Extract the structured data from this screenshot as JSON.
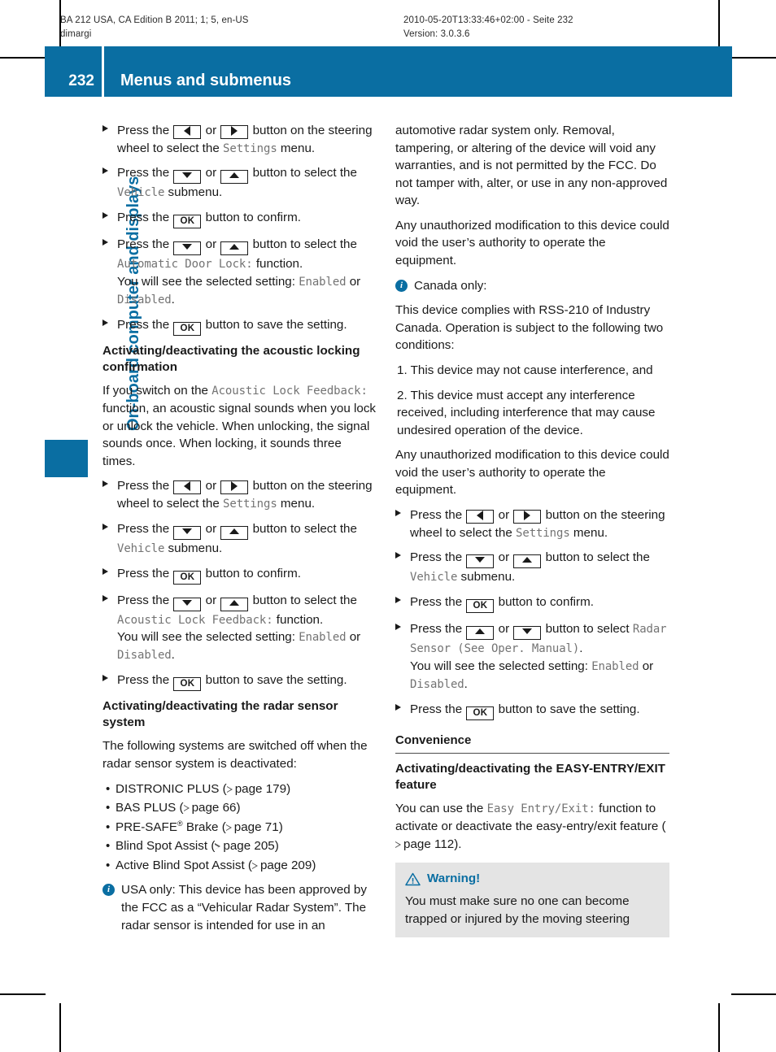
{
  "runhead": {
    "left_line1": "BA 212 USA, CA Edition B 2011; 1; 5, en-US",
    "left_line2": "dimargi",
    "right_line1": "2010-05-20T13:33:46+02:00 - Seite 232",
    "right_line2": "Version: 3.0.3.6"
  },
  "header": {
    "page_number": "232",
    "title": "Menus and submenus",
    "accent_color": "#0a6ea2"
  },
  "chapter_tab": {
    "label": "On-board computer and displays"
  },
  "left_column": {
    "steps_door_lock": [
      {
        "t1": "Press the",
        "btn_a": "arrow-left",
        "or": "or",
        "btn_b": "arrow-right",
        "t2": "button on the steering wheel to select the",
        "mono": "Settings",
        "t3": "menu."
      },
      {
        "t1": "Press the",
        "btn_a": "arrow-down",
        "or": "or",
        "btn_b": "arrow-up",
        "t2": "button to select the",
        "mono": "Vehicle",
        "t3": "submenu."
      },
      {
        "t1": "Press the",
        "btn_a": "OK",
        "t2": "button to confirm."
      },
      {
        "t1": "Press the",
        "btn_a": "arrow-down",
        "or": "or",
        "btn_b": "arrow-up",
        "t2": "button to select the",
        "mono": "Automatic Door Lock:",
        "t3": "function.",
        "t4": "You will see the selected setting:",
        "mono2": "Enabled",
        "t5": "or",
        "mono3": "Disabled",
        "t6": "."
      },
      {
        "t1": "Press the",
        "btn_a": "OK",
        "t2": "button to save the setting."
      }
    ],
    "heading_acoustic": "Activating/deactivating the acoustic locking confirmation",
    "acoustic_intro": {
      "t1": "If you switch on the",
      "mono": "Acoustic Lock Feedback:",
      "t2": "function, an acoustic signal sounds when you lock or unlock the vehicle. When unlocking, the signal sounds once. When locking, it sounds three times."
    },
    "steps_acoustic": [
      {
        "t1": "Press the",
        "btn_a": "arrow-left",
        "or": "or",
        "btn_b": "arrow-right",
        "t2": "button on the steering wheel to select the",
        "mono": "Settings",
        "t3": "menu."
      },
      {
        "t1": "Press the",
        "btn_a": "arrow-down",
        "or": "or",
        "btn_b": "arrow-up",
        "t2": "button to select the",
        "mono": "Vehicle",
        "t3": "submenu."
      },
      {
        "t1": "Press the",
        "btn_a": "OK",
        "t2": "button to confirm."
      },
      {
        "t1": "Press the",
        "btn_a": "arrow-down",
        "or": "or",
        "btn_b": "arrow-up",
        "t2": "button to select the",
        "mono": "Acoustic Lock Feedback:",
        "t3": "function.",
        "t4": "You will see the selected setting:",
        "mono2": "Enabled",
        "t5": "or",
        "mono3": "Disabled",
        "t6": "."
      },
      {
        "t1": "Press the",
        "btn_a": "OK",
        "t2": "button to save the setting."
      }
    ],
    "heading_radar": "Activating/deactivating the radar sensor system",
    "radar_intro": "The following systems are switched off when the radar sensor system is deactivated:",
    "radar_list": [
      {
        "name": "DISTRONIC PLUS",
        "ref": "page 179"
      },
      {
        "name": "BAS PLUS",
        "ref": "page 66"
      },
      {
        "name": "PRE-SAFE",
        "reg": "®",
        "suffix": " Brake",
        "ref": "page 71"
      },
      {
        "name": "Blind Spot Assist",
        "ref": "page 205"
      },
      {
        "name": "Active Blind Spot Assist",
        "ref": "page 209"
      }
    ],
    "note_usa": "USA only: This device has been approved by the FCC as a “Vehicular Radar System”. The radar sensor is intended for use in an"
  },
  "right_column": {
    "note_usa_continued": "automotive radar system only. Removal, tampering, or altering of the device will void any warranties, and is not permitted by the FCC. Do not tamper with, alter, or use in any non-approved way.",
    "unauthorized_1": "Any unauthorized modification to this device could void the user’s authority to operate the equipment.",
    "note_canada_label": "Canada only:",
    "canada_intro": "This device complies with RSS-210 of Industry Canada. Operation is subject to the following two conditions:",
    "condition_1": "1. This device may not cause interference, and",
    "condition_2": "2. This device must accept any interference received, including interference that may cause undesired operation of the device.",
    "unauthorized_2": "Any unauthorized modification to this device could void the user’s authority to operate the equipment.",
    "steps_radar": [
      {
        "t1": "Press the",
        "btn_a": "arrow-left",
        "or": "or",
        "btn_b": "arrow-right",
        "t2": "button on the steering wheel to select the",
        "mono": "Settings",
        "t3": "menu."
      },
      {
        "t1": "Press the",
        "btn_a": "arrow-down",
        "or": "or",
        "btn_b": "arrow-up",
        "t2": "button to select the",
        "mono": "Vehicle",
        "t3": "submenu."
      },
      {
        "t1": "Press the",
        "btn_a": "OK",
        "t2": "button to confirm."
      },
      {
        "t1": "Press the",
        "btn_a": "arrow-up",
        "or": "or",
        "btn_b": "arrow-down",
        "t2": "button to select",
        "mono": "Radar Sensor (See Oper. Manual)",
        "t3": ".",
        "t4": "You will see the selected setting:",
        "mono2": "Enabled",
        "t5": "or",
        "mono3": "Disabled",
        "t6": "."
      },
      {
        "t1": "Press the",
        "btn_a": "OK",
        "t2": "button to save the setting."
      }
    ],
    "section_convenience": "Convenience",
    "heading_easy_entry": "Activating/deactivating the EASY-ENTRY/EXIT feature",
    "easy_entry_body": {
      "t1": "You can use the",
      "mono": "Easy Entry/Exit:",
      "t2": "function to activate or deactivate the easy-entry/exit feature (",
      "ref": "page 112",
      "t3": ")."
    },
    "warning": {
      "label": "Warning!",
      "body": "You must make sure no one can become trapped or injured by the moving steering",
      "color": "#0a6ea2",
      "bg": "#e4e4e4"
    }
  }
}
